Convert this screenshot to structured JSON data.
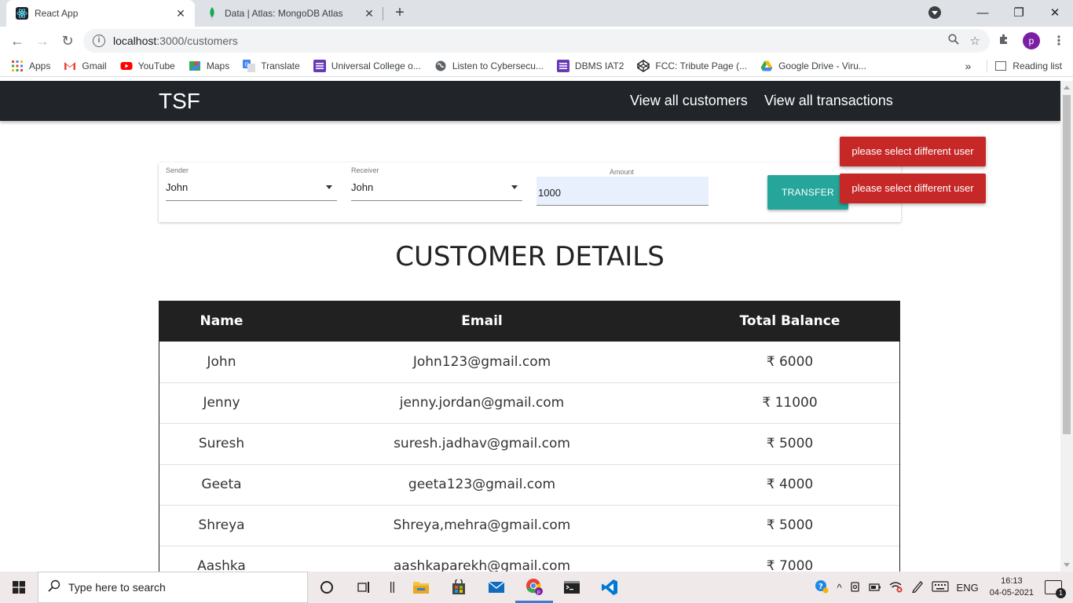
{
  "browser": {
    "tabs": [
      {
        "title": "React App",
        "active": true
      },
      {
        "title": "Data | Atlas: MongoDB Atlas",
        "active": false
      }
    ],
    "url_host": "localhost",
    "url_path": ":3000/customers",
    "profile_initial": "p",
    "bookmarks": [
      {
        "label": "Apps",
        "icon": "apps-grid-icon",
        "color": "#ea4335"
      },
      {
        "label": "Gmail",
        "icon": "gmail-icon",
        "color": "#ea4335"
      },
      {
        "label": "YouTube",
        "icon": "youtube-icon",
        "color": "#ff0000"
      },
      {
        "label": "Maps",
        "icon": "maps-icon",
        "color": "#34a853"
      },
      {
        "label": "Translate",
        "icon": "translate-icon",
        "color": "#4285f4"
      },
      {
        "label": "Universal College o...",
        "icon": "purple-list-icon",
        "color": "#673ab7"
      },
      {
        "label": "Listen to Cybersecu...",
        "icon": "globe-icon",
        "color": "#5f6368"
      },
      {
        "label": "DBMS IAT2",
        "icon": "purple-list-icon",
        "color": "#673ab7"
      },
      {
        "label": "FCC: Tribute Page (...",
        "icon": "codepen-icon",
        "color": "#222222"
      },
      {
        "label": "Google Drive - Viru...",
        "icon": "drive-icon",
        "color": "#fbbc04"
      }
    ],
    "reading_list": "Reading list",
    "overflow": "»"
  },
  "navbar": {
    "brand": "TSF",
    "links": [
      "View all customers",
      "View all transactions"
    ]
  },
  "form": {
    "sender_label": "Sender",
    "sender_value": "John",
    "receiver_label": "Receiver",
    "receiver_value": "John",
    "amount_label": "Amount",
    "amount_value": "1000",
    "button_label": "TRANSFER",
    "button_color": "#26a69a"
  },
  "toasts": [
    "please select different user",
    "please select different user"
  ],
  "toast_color": "#c62828",
  "heading": "CUSTOMER DETAILS",
  "table": {
    "headers": [
      "Name",
      "Email",
      "Total Balance"
    ],
    "rows": [
      [
        "John",
        "John123@gmail.com",
        "₹ 6000"
      ],
      [
        "Jenny",
        "jenny.jordan@gmail.com",
        "₹ 11000"
      ],
      [
        "Suresh",
        "suresh.jadhav@gmail.com",
        "₹ 5000"
      ],
      [
        "Geeta",
        "geeta123@gmail.com",
        "₹ 4000"
      ],
      [
        "Shreya",
        "Shreya,mehra@gmail.com",
        "₹ 5000"
      ],
      [
        "Aashka",
        "aashkaparekh@gmail.com",
        "₹ 7000"
      ]
    ]
  },
  "taskbar": {
    "search_placeholder": "Type here to search",
    "language": "ENG",
    "time": "16:13",
    "date": "04-05-2021",
    "notification_count": "1"
  }
}
